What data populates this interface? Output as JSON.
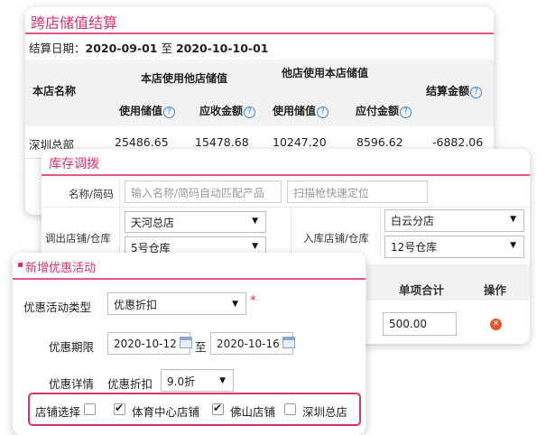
{
  "settlement": {
    "title": "跨店储值结算",
    "date_label": "结算日期：",
    "date_from": "2020-09-01",
    "date_sep": "至",
    "date_to": "2020-10-10-01",
    "headers": {
      "store_name": "本店名称",
      "own_group": "本店使用他店储值",
      "other_group": "他店使用本店储值",
      "amount": "结算金额",
      "used_value_a": "使用储值",
      "receivable": "应收金额",
      "used_value_b": "使用储值",
      "payable": "应付金额"
    },
    "rows": [
      {
        "store": "深圳总部",
        "used_a": "25486.65",
        "receivable": "15478.68",
        "used_b": "10247.20",
        "payable": "8596.62",
        "amount": "-6882.06"
      }
    ]
  },
  "inventory": {
    "title": "库存调拨",
    "name_label": "名称/简码",
    "name_placeholder": "输入名称/简码自动匹配产品",
    "scan_placeholder": "扫描枪快速定位",
    "out_label": "调出店铺/仓库",
    "out_store": "天河总店",
    "out_warehouse": "5号仓库",
    "in_label": "入库店铺/仓库",
    "in_store": "白云分店",
    "in_warehouse": "12号仓库",
    "col_subtotal": "单项合计",
    "col_action": "操作",
    "subtotal_value": "500.00"
  },
  "promotion": {
    "title": "新增优惠活动",
    "type_label": "优惠活动类型",
    "type_value": "优惠折扣",
    "required_mark": "*",
    "period_label": "优惠期限",
    "period_from": "2020-10-12",
    "period_sep": "至",
    "period_to": "2020-10-16",
    "detail_label": "优惠详情",
    "discount_label": "优惠折扣",
    "discount_value": "9.0折",
    "store_select_label": "店铺选择",
    "stores": [
      {
        "name": "体育中心店铺",
        "checked": true
      },
      {
        "name": "佛山店铺",
        "checked": true
      },
      {
        "name": "深圳总店",
        "checked": false
      }
    ]
  },
  "colors": {
    "accent": "#d6336c",
    "accent_border": "#e0578a",
    "info_icon": "#3a86d8",
    "delete_icon": "#e8572b"
  },
  "icons": [
    "help-icon",
    "calendar-icon",
    "dropdown-arrow-icon",
    "delete-icon",
    "checkbox-icon",
    "bullet-icon"
  ]
}
